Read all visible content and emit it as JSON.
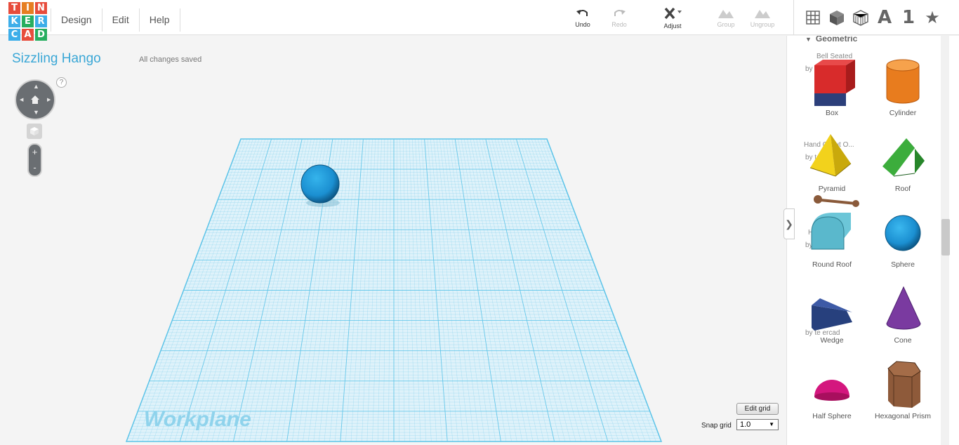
{
  "logo": {
    "letters": [
      "T",
      "I",
      "N",
      "K",
      "E",
      "R",
      "C",
      "A",
      "D"
    ],
    "colors": [
      "#e74c3c",
      "#e67e22",
      "#e74c3c",
      "#3daee9",
      "#27ae60",
      "#3daee9",
      "#3daee9",
      "#e74c3c",
      "#27ae60"
    ]
  },
  "menu": [
    "Design",
    "Edit",
    "Help"
  ],
  "toolbar": {
    "undo": "Undo",
    "redo": "Redo",
    "adjust": "Adjust",
    "group": "Group",
    "ungroup": "Ungroup",
    "text_tool": "A",
    "number_tool": "1",
    "star_tool": "★"
  },
  "design": {
    "title": "Sizzling Hango",
    "save_status": "All changes saved",
    "help": "?",
    "workplane_label": "Workplane"
  },
  "view_controls": {
    "zoom_in": "+",
    "zoom_out": "-"
  },
  "grid_controls": {
    "edit_grid": "Edit grid",
    "snap_label": "Snap grid",
    "snap_value": "1.0"
  },
  "panel": {
    "section": "Geometric",
    "collapse": "❯",
    "ghost_texts": [
      "Bell Seated",
      "by te  ercad",
      "Hand G  Cut O...",
      "by te  ercad",
      "H      ed",
      "by te  ercad",
      "          ed",
      "by te  ercad"
    ],
    "shapes": [
      {
        "label": "Box",
        "color": "#d82b2b"
      },
      {
        "label": "Cylinder",
        "color": "#e87c1e"
      },
      {
        "label": "Pyramid",
        "color": "#f2d21c"
      },
      {
        "label": "Roof",
        "color": "#3cad3c"
      },
      {
        "label": "Round Roof",
        "color": "#6cc6d8"
      },
      {
        "label": "Sphere",
        "color": "#1b8fd1"
      },
      {
        "label": "Wedge",
        "color": "#27407d"
      },
      {
        "label": "Cone",
        "color": "#7a3aa0"
      },
      {
        "label": "Half Sphere",
        "color": "#d4167e"
      },
      {
        "label": "Hexagonal Prism",
        "color": "#8e5a3a"
      }
    ]
  },
  "scene": {
    "sphere_color": "#1b8fd1",
    "grid_color": "#5bc3e8"
  }
}
